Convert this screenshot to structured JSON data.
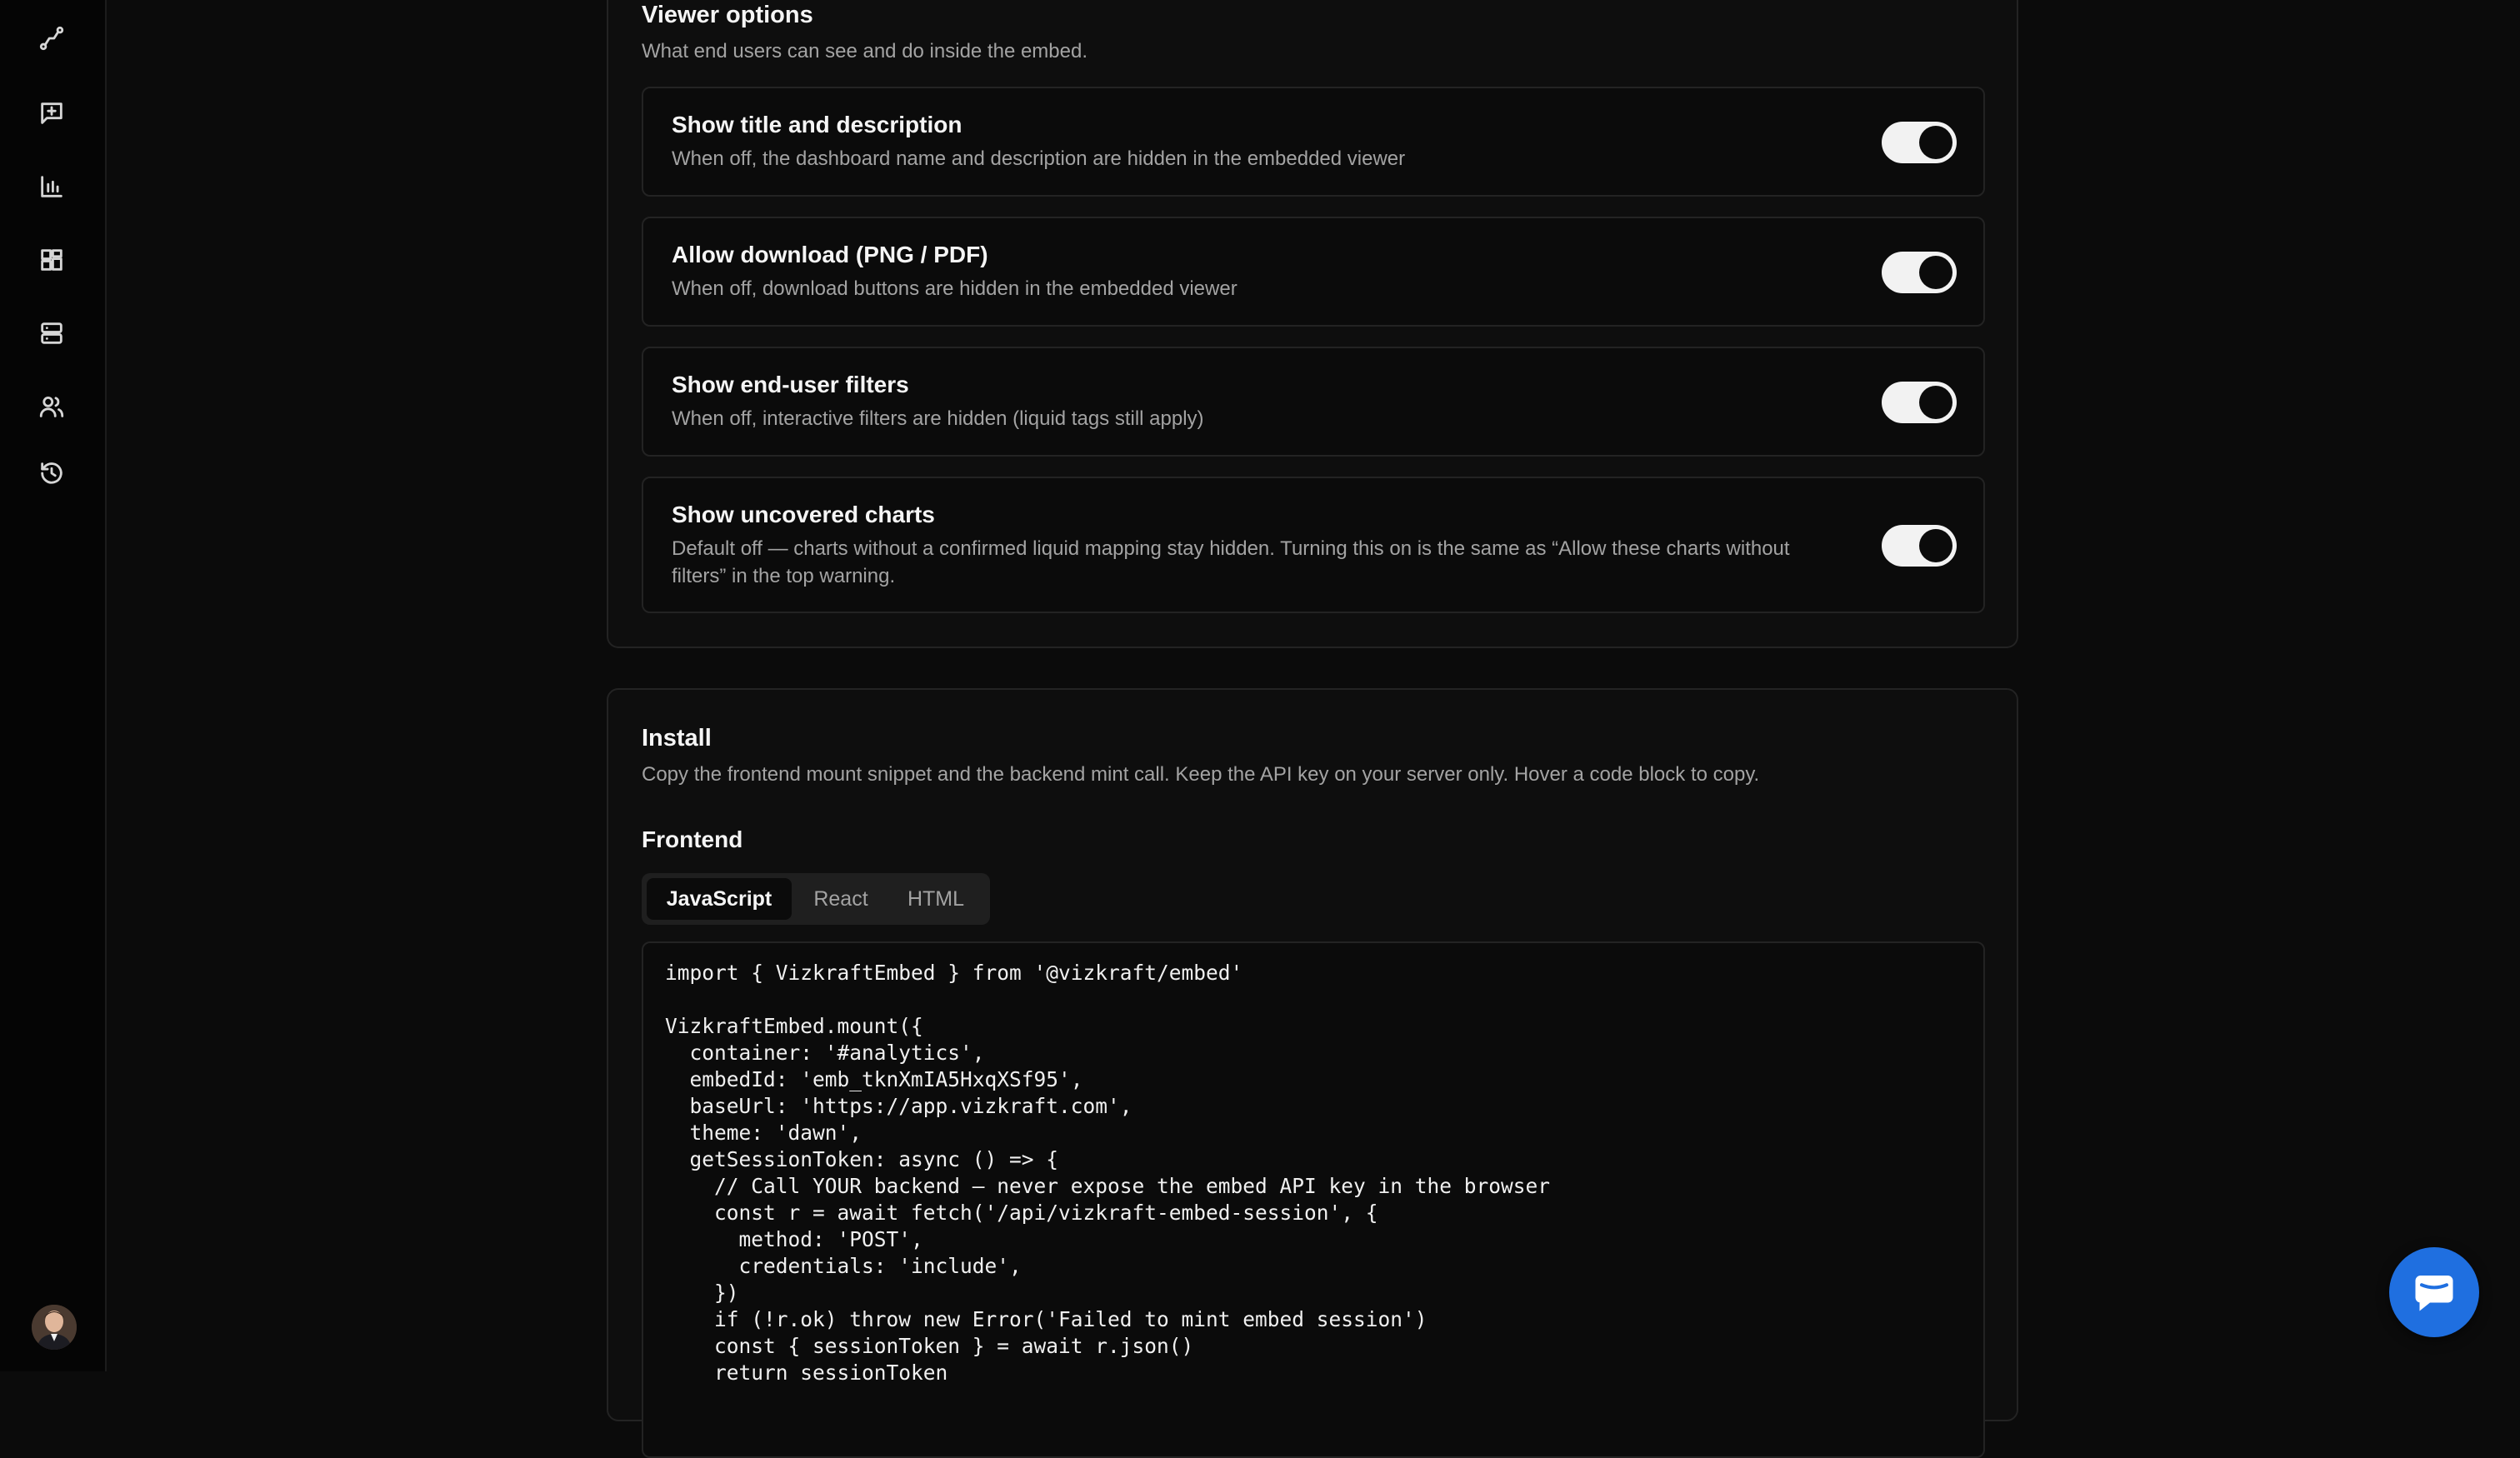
{
  "sidebar": {
    "icons": [
      {
        "name": "workflow-icon"
      },
      {
        "name": "message-plus-icon"
      },
      {
        "name": "bar-chart-icon"
      },
      {
        "name": "dashboard-icon"
      },
      {
        "name": "database-icon"
      },
      {
        "name": "users-icon"
      },
      {
        "name": "history-icon"
      }
    ]
  },
  "viewer_options": {
    "title": "Viewer options",
    "subtitle": "What end users can see and do inside the embed.",
    "options": [
      {
        "title": "Show title and description",
        "description": "When off, the dashboard name and description are hidden in the embedded viewer",
        "enabled": true
      },
      {
        "title": "Allow download (PNG / PDF)",
        "description": "When off, download buttons are hidden in the embedded viewer",
        "enabled": true
      },
      {
        "title": "Show end-user filters",
        "description": "When off, interactive filters are hidden (liquid tags still apply)",
        "enabled": true
      },
      {
        "title": "Show uncovered charts",
        "description": "Default off — charts without a confirmed liquid mapping stay hidden. Turning this on is the same as “Allow these charts without filters” in the top warning.",
        "enabled": true
      }
    ]
  },
  "install": {
    "title": "Install",
    "subtitle": "Copy the frontend mount snippet and the backend mint call. Keep the API key on your server only. Hover a code block to copy.",
    "frontend_label": "Frontend",
    "tabs": [
      {
        "label": "JavaScript",
        "active": true
      },
      {
        "label": "React",
        "active": false
      },
      {
        "label": "HTML",
        "active": false
      }
    ],
    "code": "import { VizkraftEmbed } from '@vizkraft/embed'\n\nVizkraftEmbed.mount({\n  container: '#analytics',\n  embedId: 'emb_tknXmIA5HxqXSf95',\n  baseUrl: 'https://app.vizkraft.com',\n  theme: 'dawn',\n  getSessionToken: async () => {\n    // Call YOUR backend — never expose the embed API key in the browser\n    const r = await fetch('/api/vizkraft-embed-session', {\n      method: 'POST',\n      credentials: 'include',\n    })\n    if (!r.ok) throw new Error('Failed to mint embed session')\n    const { sessionToken } = await r.json()\n    return sessionToken"
  },
  "colors": {
    "background": "#0b0b0b",
    "accent_chat": "#1f6fe0",
    "toggle_on": "#f2f2f2"
  }
}
